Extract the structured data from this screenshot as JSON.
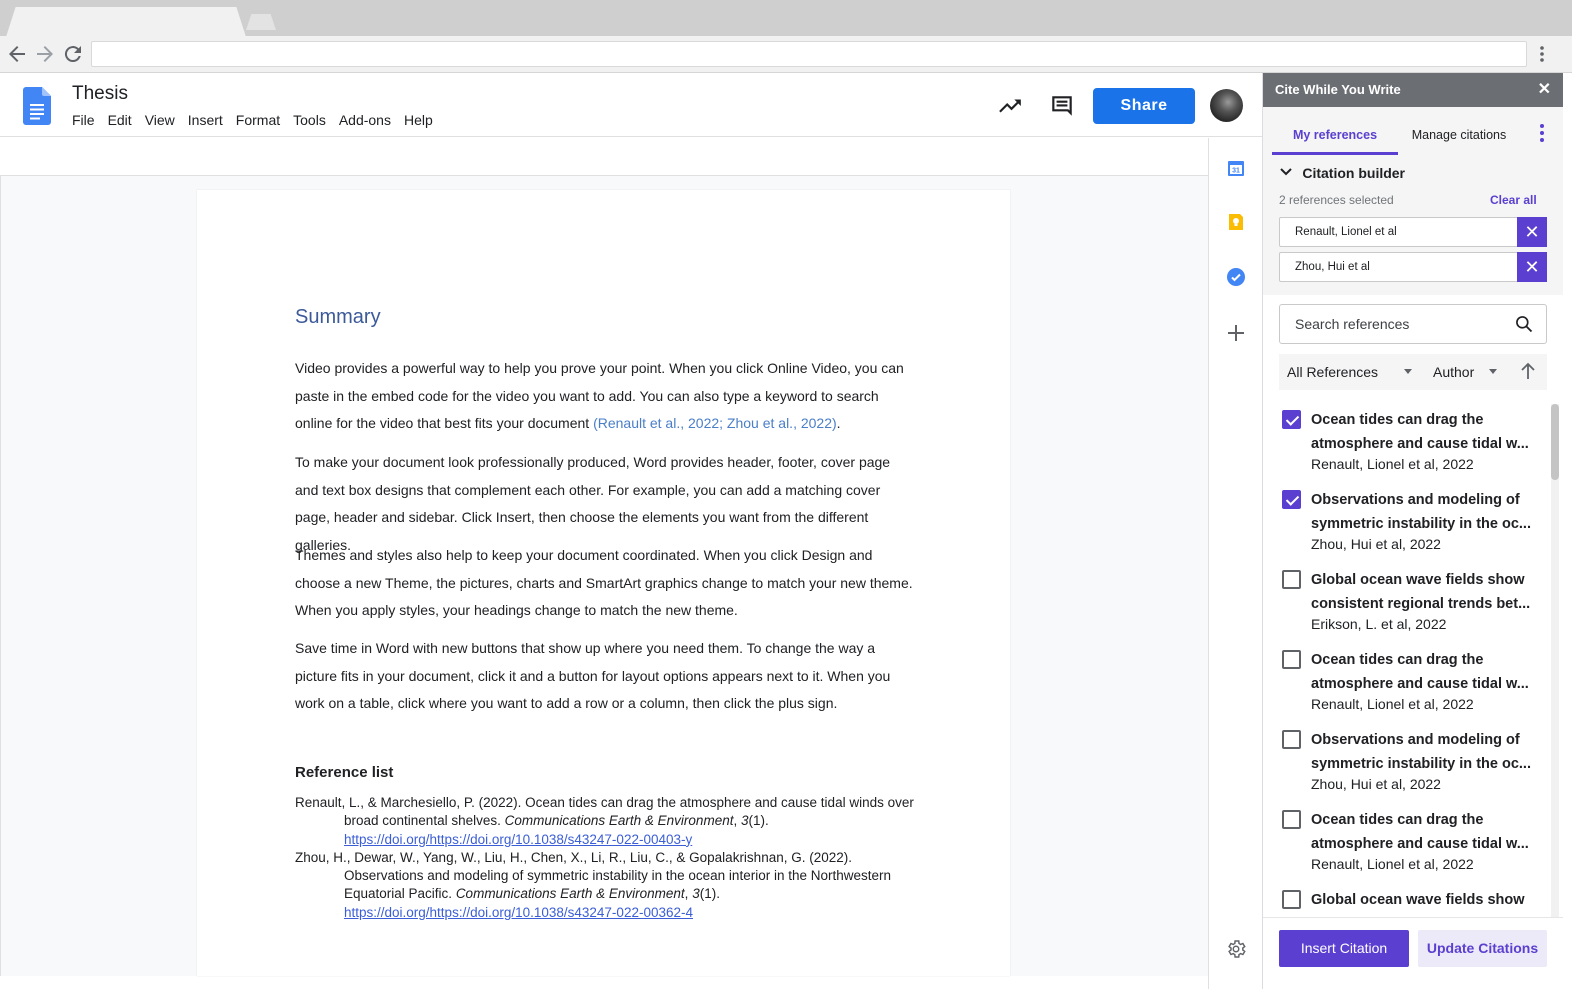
{
  "browser": {
    "address_value": "",
    "icons": [
      "back-arrow-icon",
      "forward-arrow-icon",
      "reload-icon",
      "more-vertical-icon"
    ]
  },
  "docs": {
    "title": "Thesis",
    "menu": [
      "File",
      "Edit",
      "View",
      "Insert",
      "Format",
      "Tools",
      "Add-ons",
      "Help"
    ],
    "share_label": "Share",
    "accent": "#1a73e8"
  },
  "document": {
    "heading": "Summary",
    "paragraphs": [
      {
        "text": "Video provides a powerful way to help you prove your point. When you click Online Video, you can paste in the embed code for the video you want to add. You can also type a keyword to search online for the video that best fits your document ",
        "citation": "(Renault et al., 2022; Zhou et al., 2022)",
        "tail": "."
      },
      {
        "text": "To make your document look professionally produced, Word provides header, footer, cover page and text box designs that complement each other. For example, you can add a matching cover page, header and sidebar. Click Insert, then choose the elements you want from the different galleries."
      },
      {
        "text": "Themes and styles also help to keep your document coordinated. When you click Design and choose a new Theme, the pictures, charts and SmartArt graphics change to match your new theme. When you apply styles, your headings change to match the new theme."
      },
      {
        "text": "Save time in Word with new buttons that show up where you need them. To change the way a picture fits in your document, click it and a button for layout options appears next to it. When you work on a table, click where you want to add a row or a column, then click the plus sign."
      }
    ],
    "reference_heading": "Reference list",
    "references": [
      {
        "before": "Renault, L., & Marchesiello, P. (2022). Ocean tides can drag the atmosphere and cause tidal winds over broad continental shelves. ",
        "journal": "Communications Earth & Environment",
        "sep": ", ",
        "volume": "3",
        "issue": "(1).",
        "doi": "https://doi.org/https://doi.org/10.1038/s43247-022-00403-y"
      },
      {
        "before": "Zhou, H., Dewar, W., Yang, W., Liu, H., Chen, X., Li, R., Liu, C., & Gopalakrishnan, G. (2022). Observations and modeling of symmetric instability in the ocean interior in the Northwestern Equatorial Pacific. ",
        "journal": "Communications Earth & Environment",
        "sep": ", ",
        "volume": "3",
        "issue": "(1).",
        "doi": "https://doi.org/https://doi.org/10.1038/s43247-022-00362-4"
      }
    ]
  },
  "sidebar": {
    "title": "Cite While You Write",
    "close": "✕",
    "tabs": {
      "mine": "My references",
      "manage": "Manage citations"
    },
    "builder": {
      "title": "Citation builder",
      "selected_count": "2 references selected",
      "clear_all": "Clear all",
      "chips": [
        "Renault, Lionel et al",
        "Zhou, Hui et al"
      ]
    },
    "search_placeholder": "Search references",
    "filter": {
      "collection": "All References",
      "sort_by": "Author"
    },
    "references": [
      {
        "title": "Ocean tides can drag the atmosphere and cause tidal w...",
        "meta": "Renault, Lionel et al, 2022",
        "checked": true
      },
      {
        "title": "Observations and modeling of symmetric instability in the oc...",
        "meta": "Zhou, Hui et al, 2022",
        "checked": true
      },
      {
        "title": "Global ocean wave fields show consistent regional trends bet...",
        "meta": "Erikson, L. et al, 2022",
        "checked": false
      },
      {
        "title": "Ocean tides can drag the atmosphere and cause tidal w...",
        "meta": "Renault, Lionel et al, 2022",
        "checked": false
      },
      {
        "title": "Observations and modeling of symmetric instability in the oc...",
        "meta": "Zhou, Hui et al, 2022",
        "checked": false
      },
      {
        "title": "Ocean tides can drag the atmosphere and cause tidal w...",
        "meta": "Renault, Lionel et al, 2022",
        "checked": false
      },
      {
        "title": "Global ocean wave fields show",
        "meta": "",
        "checked": false
      }
    ],
    "insert_label": "Insert Citation",
    "update_label": "Update Citations",
    "accent": "#5b3fd0"
  }
}
